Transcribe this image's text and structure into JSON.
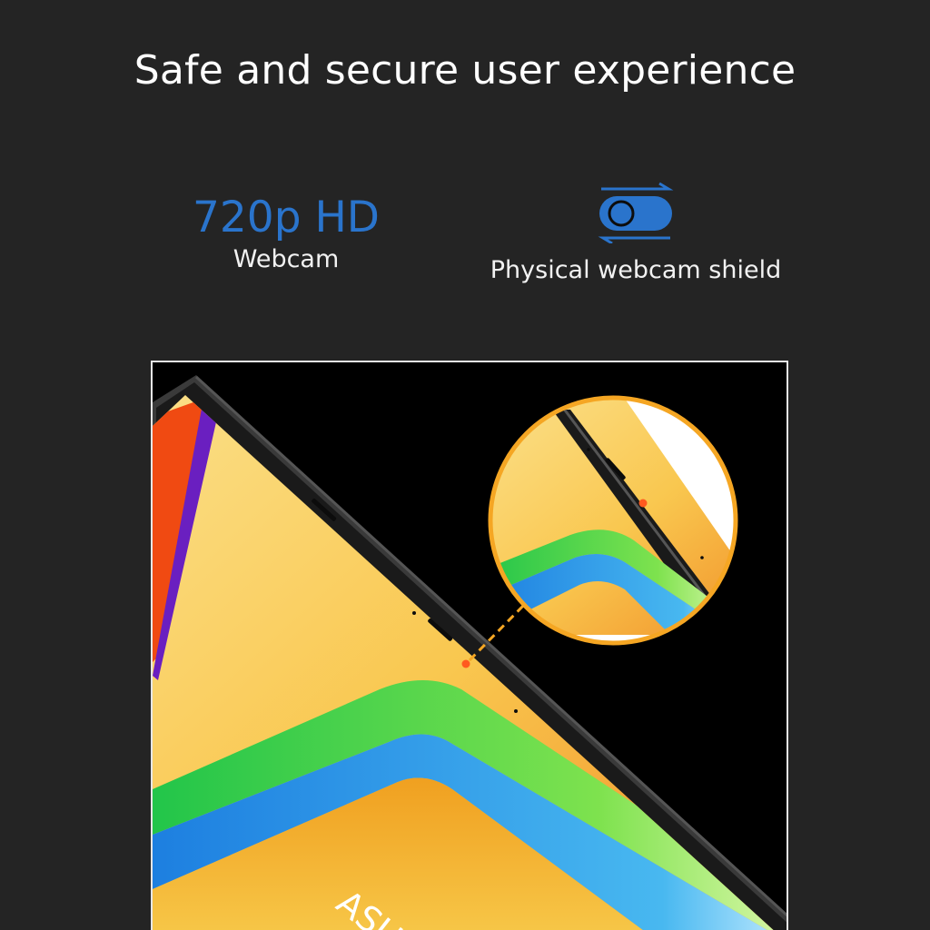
{
  "headline": "Safe and secure user experience",
  "features": [
    {
      "value": "720p HD",
      "label": "Webcam",
      "accent_color": "#2a74cc"
    },
    {
      "icon": "webcam-shield-toggle-icon",
      "label": "Physical webcam shield",
      "accent_color": "#2a74cc"
    }
  ],
  "photo": {
    "brand_text": "ASU"
  },
  "colors": {
    "background": "#242424",
    "text": "#ffffff",
    "accent": "#2a74cc",
    "highlight": "#f5a623",
    "camera_dot": "#ff5a1f"
  }
}
